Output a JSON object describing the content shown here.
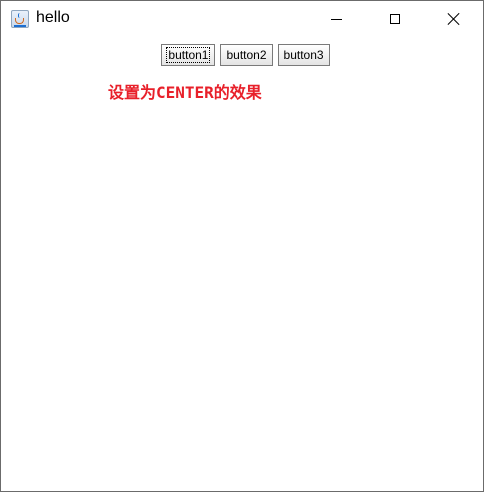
{
  "window": {
    "title": "hello",
    "app_icon": "java-icon",
    "controls": {
      "minimize_icon": "minimize-icon",
      "maximize_icon": "maximize-icon",
      "close_icon": "close-icon"
    }
  },
  "buttons": [
    {
      "label": "button1",
      "focused": true
    },
    {
      "label": "button2",
      "focused": false
    },
    {
      "label": "button3",
      "focused": false
    }
  ],
  "caption": {
    "text": "设置为CENTER的效果",
    "color": "#e8202a"
  }
}
